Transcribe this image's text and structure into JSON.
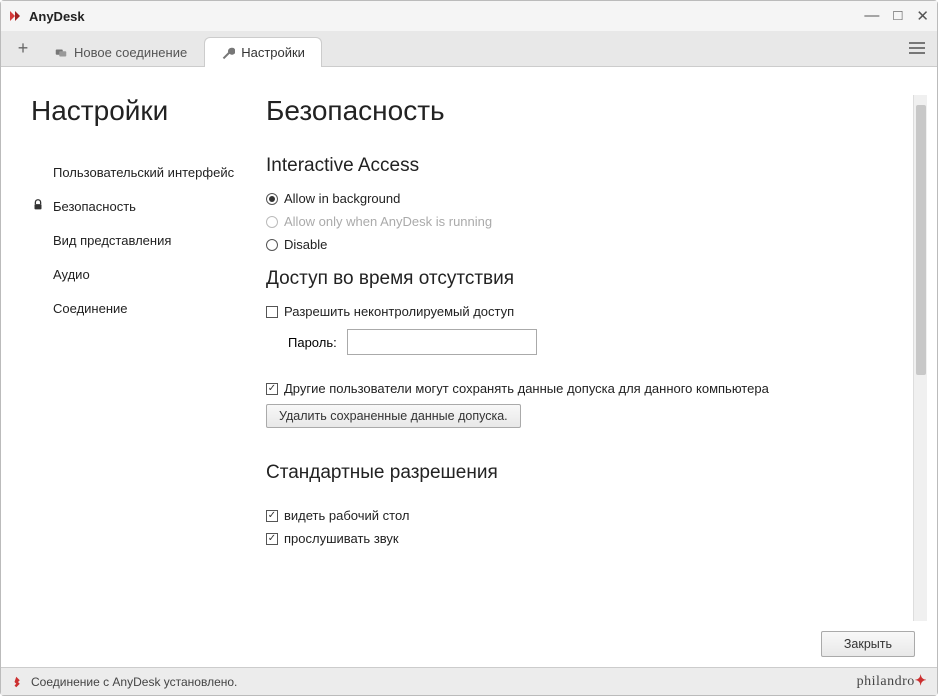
{
  "app": {
    "title": "AnyDesk"
  },
  "tabs": {
    "new_connection": "Новое соединение",
    "settings": "Настройки"
  },
  "sidebar": {
    "heading": "Настройки",
    "items": {
      "ui": "Пользовательский интерфейс",
      "security": "Безопасность",
      "display": "Вид представления",
      "audio": "Аудио",
      "connection": "Соединение"
    }
  },
  "page": {
    "title": "Безопасность"
  },
  "interactive_access": {
    "heading": "Interactive Access",
    "opt_allow_bg": "Allow in background",
    "opt_allow_running": "Allow only when AnyDesk is running",
    "opt_disable": "Disable"
  },
  "unattended": {
    "heading": "Доступ во время отсутствия",
    "allow_unattended": "Разрешить неконтролируемый доступ",
    "password_label": "Пароль:",
    "others_store": "Другие пользователи могут сохранять данные допуска для данного компьютера",
    "clear_btn": "Удалить сохраненные данные допуска."
  },
  "default_perms": {
    "heading": "Стандартные разрешения",
    "view_screen": "видеть рабочий стол",
    "hear_audio": "прослушивать звук"
  },
  "footer": {
    "close": "Закрыть"
  },
  "status": {
    "text": "Соединение с AnyDesk установлено.",
    "brand": "philandro"
  }
}
